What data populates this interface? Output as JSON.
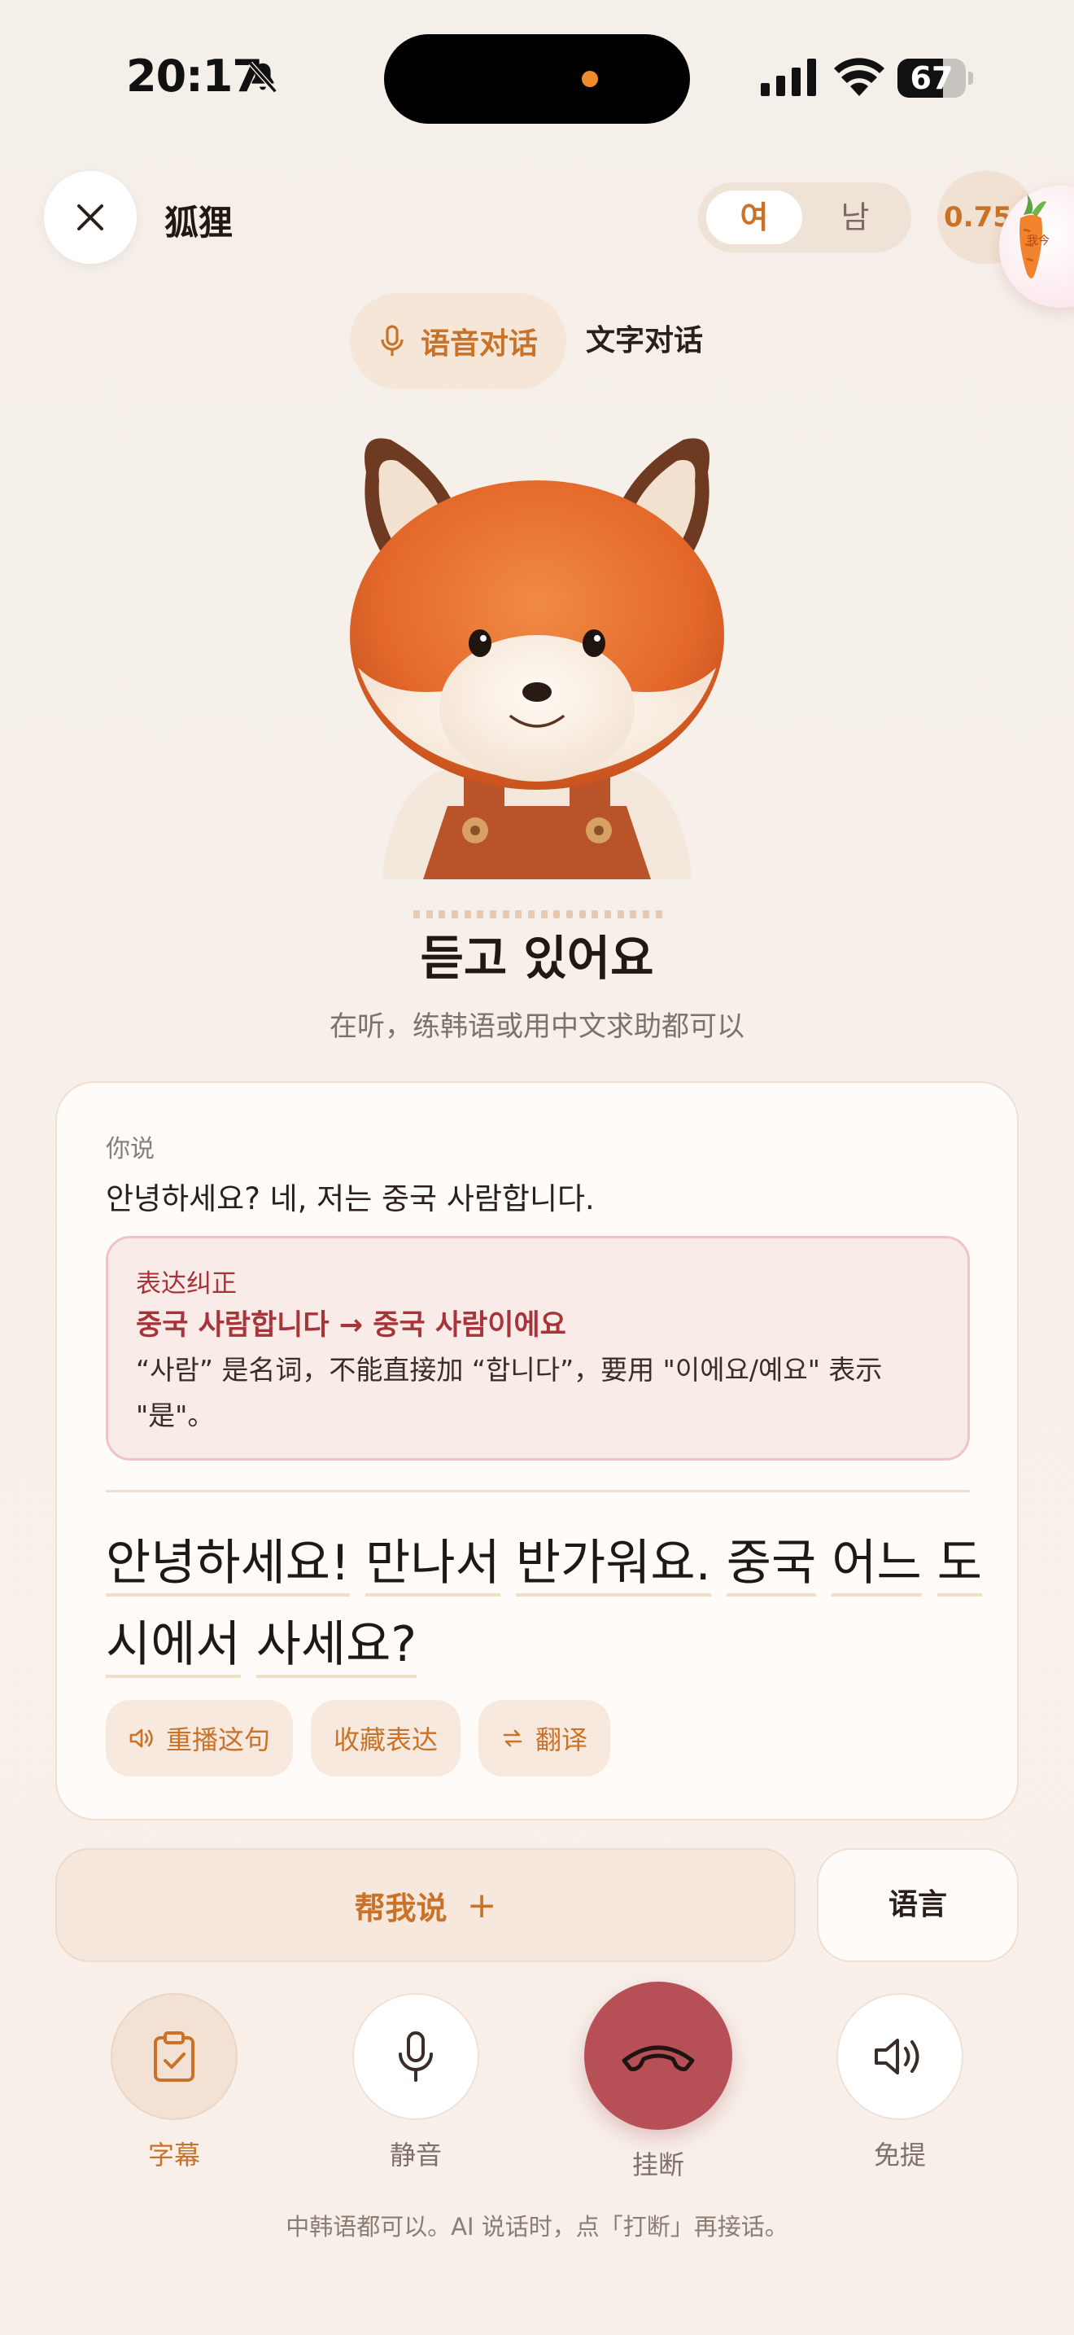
{
  "status_bar": {
    "time": "20:17",
    "battery_level": "67",
    "battery_fraction": 0.67
  },
  "header": {
    "title": "狐狸",
    "gender_female": "여",
    "gender_male": "남",
    "speed": "0.75x",
    "badge_text": "我今"
  },
  "mode_tabs": {
    "voice": "语音对话",
    "text": "文字对话"
  },
  "listening": {
    "title": "듣고 있어요",
    "subtitle": "在听，练韩语或用中文求助都可以"
  },
  "card": {
    "you_said_label": "你说",
    "you_said_text": "안녕하세요? 네, 저는 중국 사람합니다.",
    "correction": {
      "label": "表达纠正",
      "main": "중국 사람합니다 → 중국 사람이에요",
      "explanation": "“사람” 是名词，不能直接加 “합니다”，要用 \"이에요/예요\" 表示 \"是\"。"
    },
    "ai_reply_words": [
      "안녕하세요!",
      "만나서",
      "반가워요.",
      "중국",
      "어느",
      "도시에서",
      "사세요?"
    ],
    "actions": {
      "replay": "重播这句",
      "save": "收藏表达",
      "translate": "翻译"
    }
  },
  "help": {
    "help_me_say": "帮我说",
    "plus": "+",
    "language": "语言"
  },
  "controls": {
    "subtitles": "字幕",
    "mute": "静音",
    "hangup": "挂断",
    "speaker": "免提"
  },
  "footer_hint": "中韩语都可以。AI 说话时，点「打断」再接话。",
  "colors": {
    "accent": "#c97228",
    "hangup": "#b74f57",
    "correction": "#a8343a"
  }
}
